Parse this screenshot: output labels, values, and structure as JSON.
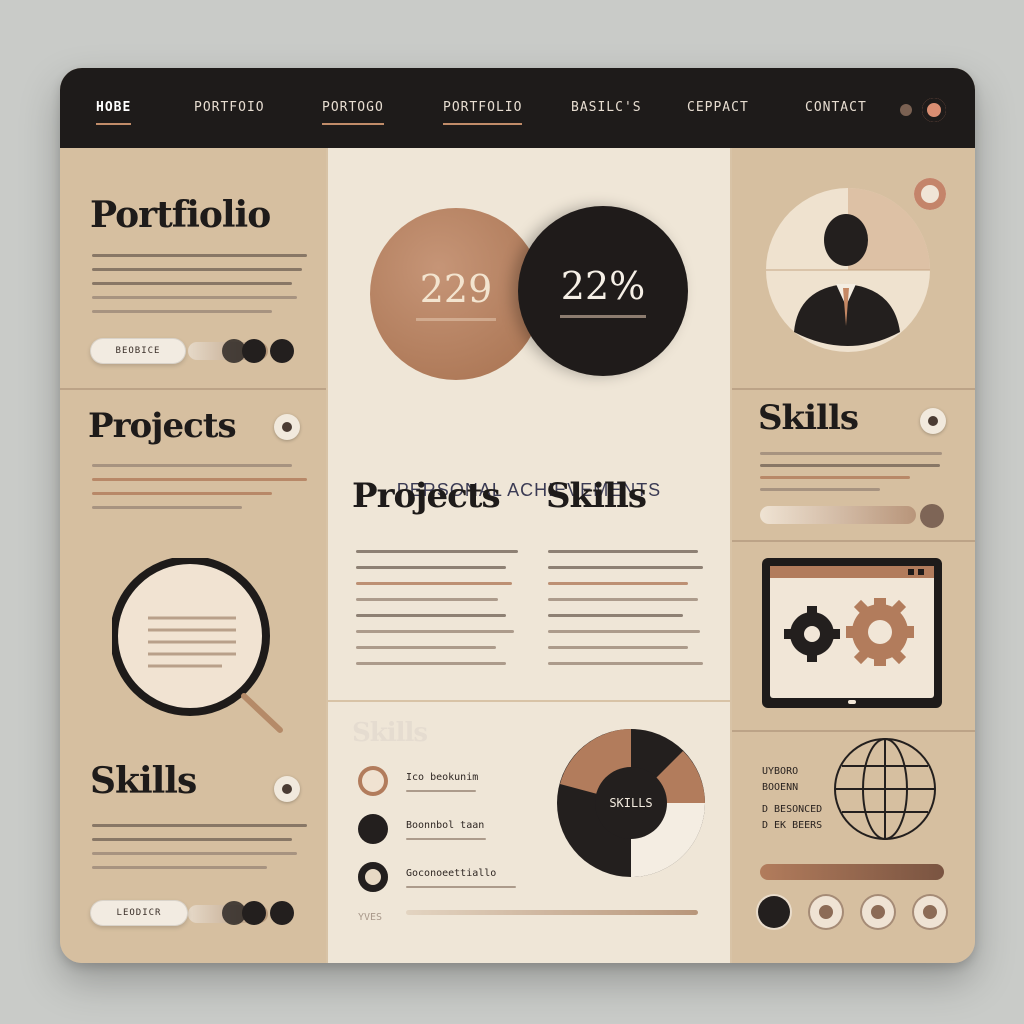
{
  "nav": {
    "items": [
      "HOBE",
      "PORTFOIO",
      "PORTOGO",
      "PORTFOLIO",
      "BASILC'S",
      "CEPPACT",
      "CONTACT"
    ]
  },
  "left": {
    "portfolio_title": "Portfiolio",
    "portfolio_button": "BEOBICE",
    "projects_title": "Projects",
    "skills_title": "Skills",
    "skills_button": "LEODICR"
  },
  "center": {
    "stat_left_value": "229",
    "stat_right_value": "22%",
    "achievements_title": "PERSONAL ACHIEVEMENTS",
    "projects_heading": "Projects",
    "skills_heading": "Skills",
    "faded_heading": "Skills",
    "legend": [
      "Ico beokunim",
      "Boonnbol taan",
      "Goconoeettiallo"
    ],
    "donut_label": "SKILLS",
    "footer_label": "YVES"
  },
  "right": {
    "skills_title": "Skills",
    "globe_lines": [
      "UYBORO",
      "BOOENN",
      "D BESONCED",
      "D EK BEERS"
    ]
  },
  "colors": {
    "brand_dark": "#1e1b1a",
    "copper": "#b27c5c",
    "tan": "#d6bfa0",
    "cream": "#efe6d7"
  }
}
